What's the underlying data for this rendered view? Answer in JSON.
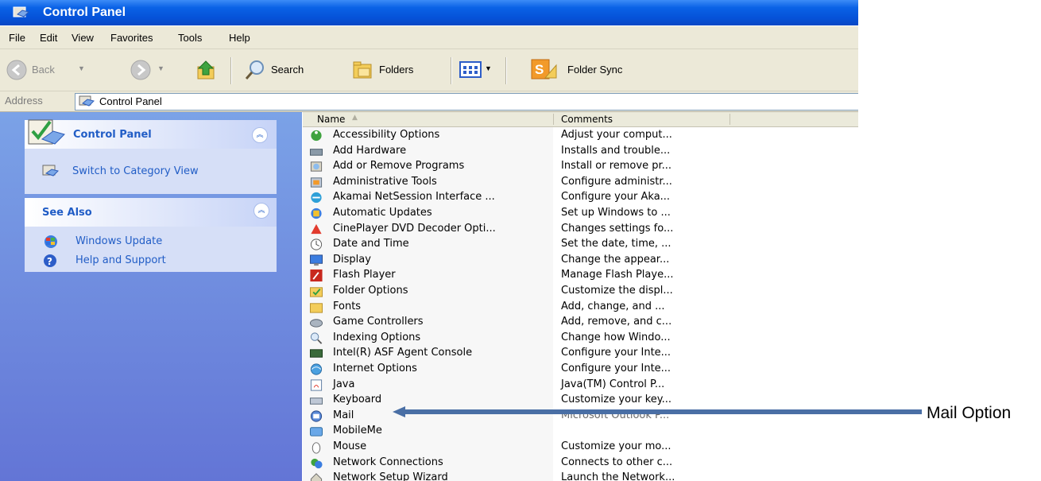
{
  "window": {
    "title": "Control Panel"
  },
  "menu": [
    "File",
    "Edit",
    "View",
    "Favorites",
    "Tools",
    "Help"
  ],
  "toolbar": {
    "back": "Back",
    "search": "Search",
    "folders": "Folders",
    "folder_sync": "Folder Sync"
  },
  "address": {
    "label": "Address",
    "value": "Control Panel"
  },
  "sidebar": {
    "control_panel": {
      "title": "Control Panel",
      "switch_link": "Switch to Category View"
    },
    "see_also": {
      "title": "See Also",
      "links": [
        "Windows Update",
        "Help and Support"
      ]
    }
  },
  "list": {
    "columns": {
      "name": "Name",
      "comments": "Comments"
    },
    "items": [
      {
        "name": "Accessibility Options",
        "comment": "Adjust your comput..."
      },
      {
        "name": "Add Hardware",
        "comment": "Installs and trouble..."
      },
      {
        "name": "Add or Remove Programs",
        "comment": "Install or remove pr..."
      },
      {
        "name": "Administrative Tools",
        "comment": "Configure administr..."
      },
      {
        "name": "Akamai NetSession Interface ...",
        "comment": "Configure your Aka..."
      },
      {
        "name": "Automatic Updates",
        "comment": "Set up Windows to ..."
      },
      {
        "name": "CinePlayer DVD Decoder Opti...",
        "comment": "Changes settings fo..."
      },
      {
        "name": "Date and Time",
        "comment": "Set the date, time, ..."
      },
      {
        "name": "Display",
        "comment": "Change the appear..."
      },
      {
        "name": "Flash Player",
        "comment": "Manage Flash Playe..."
      },
      {
        "name": "Folder Options",
        "comment": "Customize the displ..."
      },
      {
        "name": "Fonts",
        "comment": "Add, change, and ..."
      },
      {
        "name": "Game Controllers",
        "comment": "Add, remove, and c..."
      },
      {
        "name": "Indexing Options",
        "comment": "Change how Windo..."
      },
      {
        "name": "Intel(R) ASF Agent Console",
        "comment": "Configure your Inte..."
      },
      {
        "name": "Internet Options",
        "comment": "Configure your Inte..."
      },
      {
        "name": "Java",
        "comment": "Java(TM) Control P..."
      },
      {
        "name": "Keyboard",
        "comment": "Customize your key..."
      },
      {
        "name": "Mail",
        "comment": "Microsoft Outlook P..."
      },
      {
        "name": "MobileMe",
        "comment": ""
      },
      {
        "name": "Mouse",
        "comment": "Customize your mo..."
      },
      {
        "name": "Network Connections",
        "comment": "Connects to other c..."
      },
      {
        "name": "Network Setup Wizard",
        "comment": "Launch the Network..."
      }
    ]
  },
  "annotation": {
    "label": "Mail Option",
    "color": "#4a6fa5"
  },
  "colors": {
    "title_bar": "#0a62e6",
    "sidebar": "#6f8fe0",
    "link": "#215dc6",
    "chrome": "#ece9d8"
  }
}
